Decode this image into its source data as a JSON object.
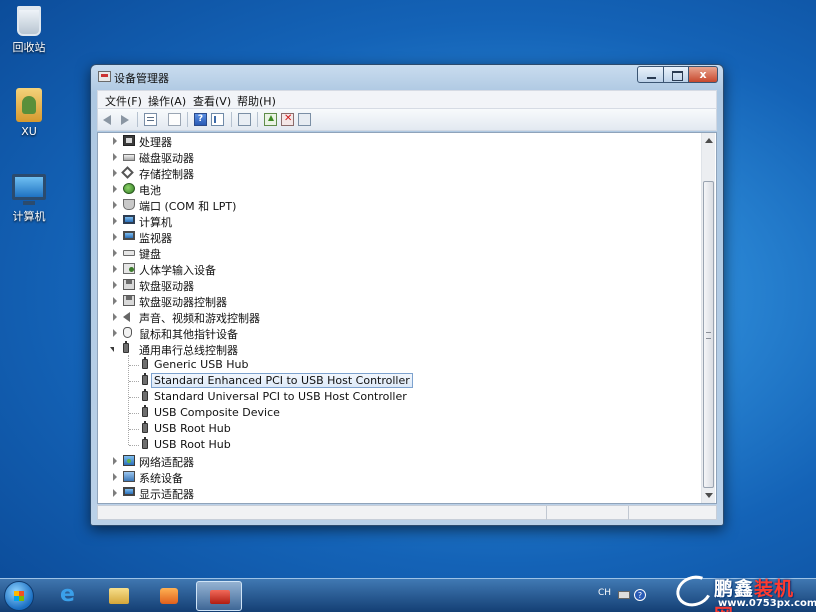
{
  "desktop": {
    "icons": [
      {
        "label": "回收站",
        "icon": "recycle-bin-icon"
      },
      {
        "label": "XU",
        "icon": "user-folder-icon"
      },
      {
        "label": "计算机",
        "icon": "computer-icon"
      }
    ]
  },
  "window": {
    "title": "设备管理器",
    "close_label": "x",
    "menu": [
      "文件(F)",
      "操作(A)",
      "查看(V)",
      "帮助(H)"
    ],
    "toolbar": {
      "help_glyph": "?"
    },
    "tree": [
      {
        "label": "处理器",
        "icon": "processor-icon",
        "level": 0,
        "state": "collapsed"
      },
      {
        "label": "磁盘驱动器",
        "icon": "disk-drive-icon",
        "level": 0,
        "state": "collapsed"
      },
      {
        "label": "存储控制器",
        "icon": "storage-controller-icon",
        "level": 0,
        "state": "collapsed"
      },
      {
        "label": "电池",
        "icon": "battery-icon",
        "level": 0,
        "state": "collapsed"
      },
      {
        "label": "端口 (COM 和 LPT)",
        "icon": "port-icon",
        "level": 0,
        "state": "collapsed"
      },
      {
        "label": "计算机",
        "icon": "computer-icon",
        "level": 0,
        "state": "collapsed"
      },
      {
        "label": "监视器",
        "icon": "monitor-icon",
        "level": 0,
        "state": "collapsed"
      },
      {
        "label": "键盘",
        "icon": "keyboard-icon",
        "level": 0,
        "state": "collapsed"
      },
      {
        "label": "人体学输入设备",
        "icon": "hid-icon",
        "level": 0,
        "state": "collapsed"
      },
      {
        "label": "软盘驱动器",
        "icon": "floppy-drive-icon",
        "level": 0,
        "state": "collapsed"
      },
      {
        "label": "软盘驱动器控制器",
        "icon": "floppy-controller-icon",
        "level": 0,
        "state": "collapsed"
      },
      {
        "label": "声音、视频和游戏控制器",
        "icon": "sound-icon",
        "level": 0,
        "state": "collapsed"
      },
      {
        "label": "鼠标和其他指针设备",
        "icon": "mouse-icon",
        "level": 0,
        "state": "collapsed"
      },
      {
        "label": "通用串行总线控制器",
        "icon": "usb-icon",
        "level": 0,
        "state": "expanded"
      },
      {
        "label": "Generic USB Hub",
        "icon": "usb-icon",
        "level": 1,
        "state": "leaf"
      },
      {
        "label": "Standard Enhanced PCI to USB Host Controller",
        "icon": "usb-icon",
        "level": 1,
        "state": "leaf",
        "selected": true
      },
      {
        "label": "Standard Universal PCI to USB Host Controller",
        "icon": "usb-icon",
        "level": 1,
        "state": "leaf"
      },
      {
        "label": "USB Composite Device",
        "icon": "usb-icon",
        "level": 1,
        "state": "leaf"
      },
      {
        "label": "USB Root Hub",
        "icon": "usb-icon",
        "level": 1,
        "state": "leaf"
      },
      {
        "label": "USB Root Hub",
        "icon": "usb-icon",
        "level": 1,
        "state": "leaf"
      },
      {
        "label": "网络适配器",
        "icon": "network-adapter-icon",
        "level": 0,
        "state": "collapsed"
      },
      {
        "label": "系统设备",
        "icon": "system-device-icon",
        "level": 0,
        "state": "collapsed"
      },
      {
        "label": "显示适配器",
        "icon": "display-adapter-icon",
        "level": 0,
        "state": "collapsed"
      }
    ]
  },
  "taskbar": {
    "lang": "CH",
    "help_glyph": "?"
  },
  "watermark": {
    "brand_a": "鹏鑫",
    "brand_b": "装机网",
    "url": "www.0753px.com"
  }
}
